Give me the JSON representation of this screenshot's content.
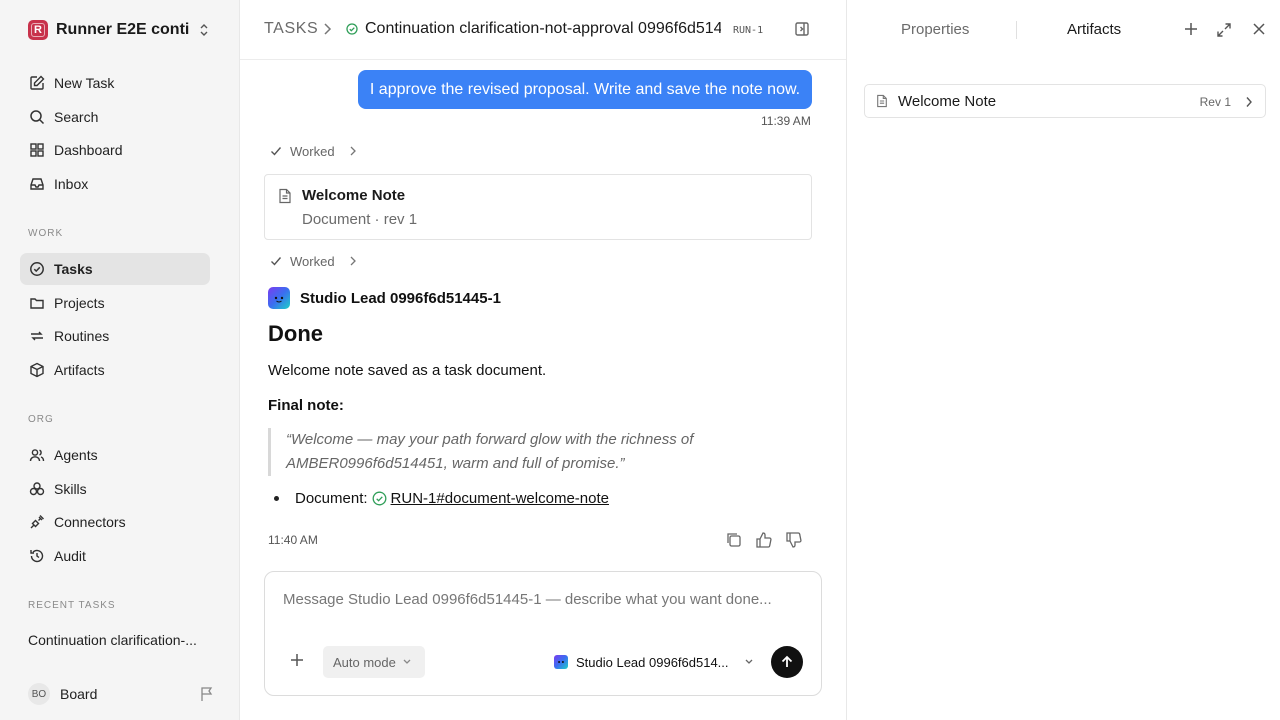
{
  "sidebar": {
    "workspace_initial": "R",
    "workspace_name": "Runner E2E conti...",
    "primary_nav": [
      {
        "label": "New Task",
        "icon": "new-task-icon"
      },
      {
        "label": "Search",
        "icon": "search-icon"
      },
      {
        "label": "Dashboard",
        "icon": "dashboard-icon"
      },
      {
        "label": "Inbox",
        "icon": "inbox-icon"
      }
    ],
    "work_label": "WORK",
    "work_nav": [
      {
        "label": "Tasks",
        "icon": "tasks-icon",
        "active": true
      },
      {
        "label": "Projects",
        "icon": "folder-icon"
      },
      {
        "label": "Routines",
        "icon": "repeat-icon"
      },
      {
        "label": "Artifacts",
        "icon": "box-icon"
      }
    ],
    "org_label": "ORG",
    "org_nav": [
      {
        "label": "Agents",
        "icon": "users-icon"
      },
      {
        "label": "Skills",
        "icon": "layers-icon"
      },
      {
        "label": "Connectors",
        "icon": "plug-icon"
      },
      {
        "label": "Audit",
        "icon": "history-icon"
      }
    ],
    "recent_label": "RECENT TASKS",
    "recent_tasks": [
      "Continuation clarification-..."
    ],
    "user": {
      "initials": "BO",
      "name": "Board"
    }
  },
  "header": {
    "section": "TASKS",
    "task_title": "Continuation clarification-not-approval 0996f6d514...",
    "run_id": "RUN-1"
  },
  "conversation": {
    "user_message": "I approve the revised proposal. Write and save the note now.",
    "user_time": "11:39 AM",
    "worked_label": "Worked",
    "doc_card": {
      "title": "Welcome Note",
      "subtitle": "Document · rev 1"
    },
    "agent_name": "Studio Lead 0996f6d51445-1",
    "heading": "Done",
    "paragraph": "Welcome note saved as a task document.",
    "final_label": "Final note:",
    "quote_line1": "“Welcome — may your path forward glow with the richness of",
    "quote_line2": "AMBER0996f6d514451, warm and full of promise.”",
    "doc_ref_label": "Document:",
    "doc_ref_link": "RUN-1#document-welcome-note",
    "agent_time": "11:40 AM"
  },
  "composer": {
    "placeholder": "Message Studio Lead 0996f6d51445-1 — describe what you want done...",
    "mode": "Auto mode",
    "agent": "Studio Lead 0996f6d514..."
  },
  "right_panel": {
    "tabs": [
      "Properties",
      "Artifacts"
    ],
    "active_tab": "Artifacts",
    "artifact": {
      "title": "Welcome Note",
      "rev": "Rev 1"
    }
  },
  "colors": {
    "accent": "#3b82f6",
    "success": "#2f9e58",
    "workspace": "#c8324b"
  }
}
